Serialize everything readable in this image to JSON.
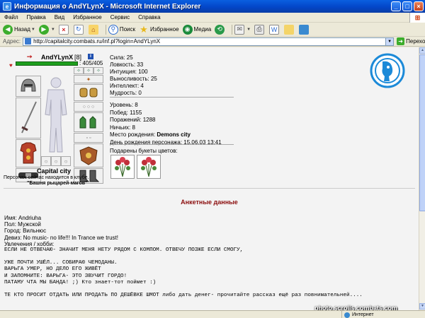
{
  "window": {
    "title": "Информация о AndYLynX - Microsoft Internet Explorer",
    "app_icon": "ie-icon",
    "controls": [
      "minimize",
      "maximize",
      "close"
    ]
  },
  "menu": {
    "items": [
      "Файл",
      "Правка",
      "Вид",
      "Избранное",
      "Сервис",
      "Справка"
    ]
  },
  "toolbar": {
    "back_label": "Назад",
    "search_label": "Поиск",
    "favorites_label": "Избранное",
    "media_label": "Медиа"
  },
  "address": {
    "label": "Адрес:",
    "value": "http://capitalcity.combats.ru/inf.pl?login=AndYLynX",
    "go_label": "Переход"
  },
  "character": {
    "nick": "AndYLynX",
    "level": "[8]",
    "hp_text": ": 405/405",
    "hp_fraction": 1.0,
    "city": "Capital city",
    "in_club": "Персонаж сейчас находится в клубе.",
    "club_name": "\"Башня рыцарей-магов\""
  },
  "stats": {
    "strength": "Сила: 25",
    "agility": "Ловкость: 33",
    "intuition": "Интуиция: 100",
    "endurance": "Выносливость: 25",
    "intellect": "Интеллект: 4",
    "wisdom": "Мудрость: 0"
  },
  "record": {
    "level": "Уровень: 8",
    "wins": "Побед: 1155",
    "losses": "Поражений: 1288",
    "draws": "Ничьих: 8",
    "birthplace_label": "Место рождения: ",
    "birthplace_value": "Demons city",
    "birthday": "День рождения персонажа: 15.06.03 13:41"
  },
  "bouquets": {
    "label": "Подарены букеты цветов:",
    "count": 2
  },
  "anketa": {
    "title": "Анкетные данные",
    "name": "Имя: Andriuha",
    "sex": "Пол: Мужской",
    "city": "Город: Вильнюс",
    "motto": "Девиз: No music- no life!!! In Trance we trust!",
    "hobby_label": "Увлечения / хобби:",
    "lines": [
      "ЕСЛИ НЕ ОТВЕЧАЮ- ЗНАЧИТ МЕНЯ НЕТУ РЯДОМ С КОМПОМ. ОТВЕЧУ ПОЗЖЕ ЕСЛИ СМОГУ,",
      "",
      "УЖЕ ПОЧТИ УШЁЛ... СОБИРАЮ ЧЕМОДАНЫ.",
      "ВАРЬГА УМЕР, НО ДЕЛО ЕГО ЖИВЁТ",
      "И ЗАПОМНИТЕ: ВАРЬГА- ЭТО ЗВУЧИТ ГОРДО!",
      "ПАТАМУ ЧТА МЫ БАНДА! ;) Кто знает-тот поймет :)",
      "",
      "ТЕ КТО ПРОСИТ ОТДАТЬ ИЛИ ПРОДАТЬ ПО ДЕШЁВКЕ ШМОТ либо дать денег- прочитайте рассказ ещё раз повнимательней...."
    ]
  },
  "status": {
    "zone": "Интернет"
  },
  "watermark": "photo.scrolls.combats.com",
  "colors": {
    "titlebar": "#0346c8",
    "hp_bar": "#1e9e1e",
    "anketa_title": "#8b0e0e",
    "page_bg": "#f3f3f3"
  }
}
